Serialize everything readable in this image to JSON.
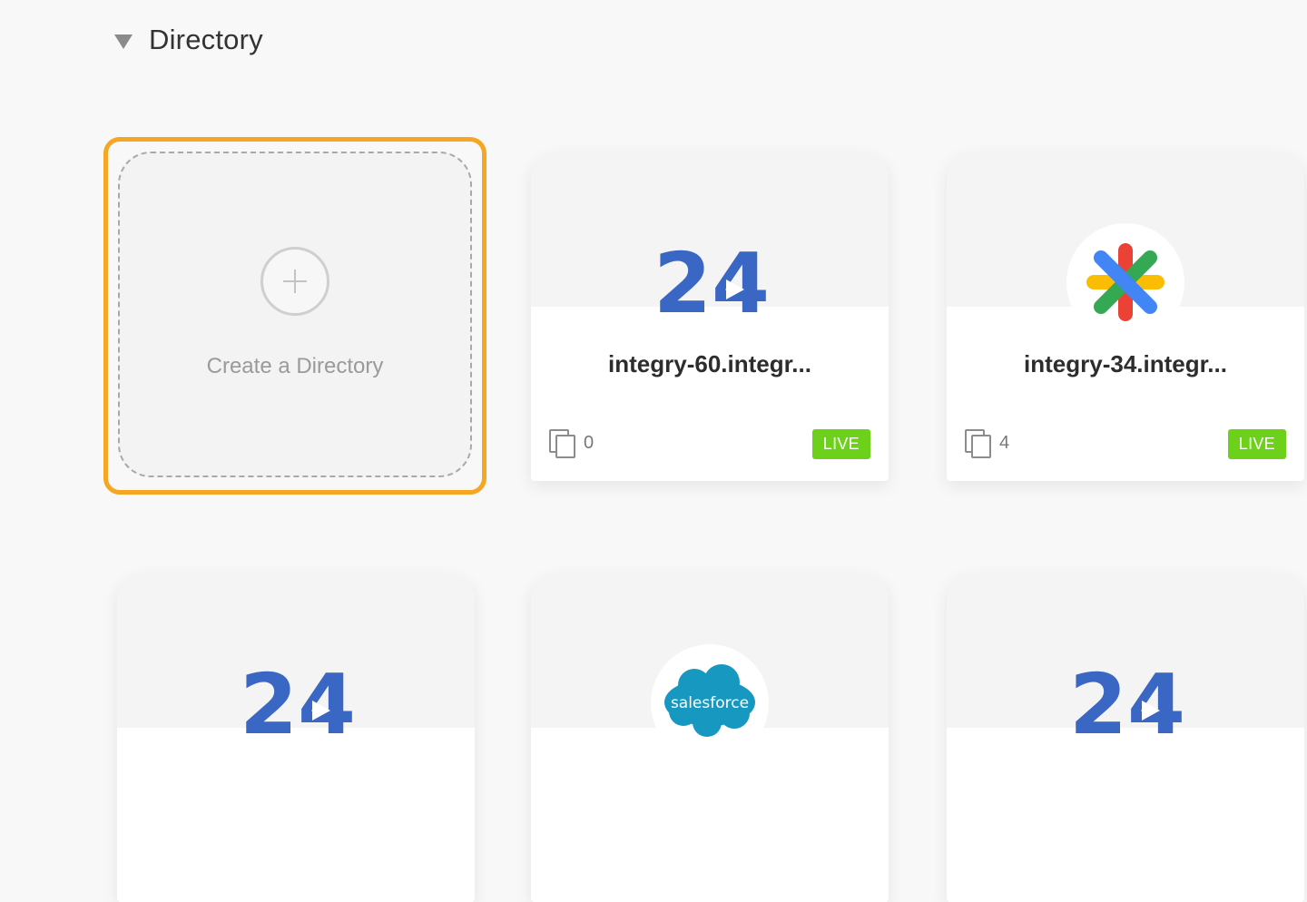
{
  "section": {
    "title": "Directory"
  },
  "create_card": {
    "label": "Create a Directory"
  },
  "cards": [
    {
      "name": "integry-60.integr...",
      "count": "0",
      "status": "LIVE",
      "logo": "24-logo"
    },
    {
      "name": "integry-34.integr...",
      "count": "4",
      "status": "LIVE",
      "logo": "google-chat-logo"
    },
    {
      "name": "",
      "count": "",
      "status": "",
      "logo": "24-logo"
    },
    {
      "name": "",
      "count": "",
      "status": "",
      "logo": "salesforce-logo"
    },
    {
      "name": "",
      "count": "",
      "status": "",
      "logo": "24-logo"
    }
  ],
  "logos": {
    "salesforce_text": "salesforce",
    "twentyfour_text": "24"
  },
  "colors": {
    "accent": "#f5a623",
    "live": "#6dd11b",
    "logo_blue": "#3a66c4",
    "salesforce": "#1798c1"
  }
}
